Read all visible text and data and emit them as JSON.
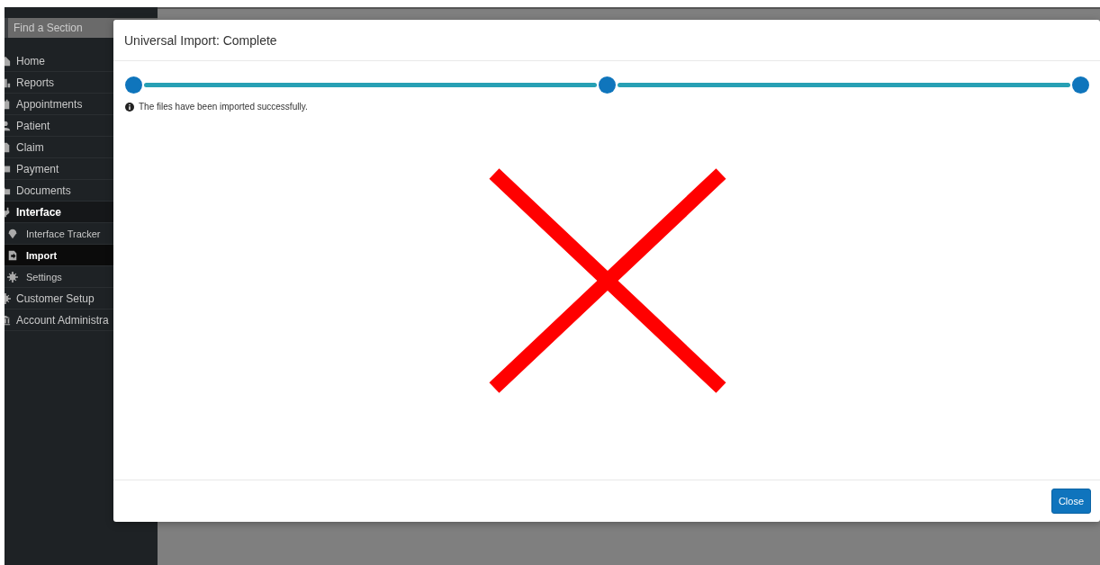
{
  "sidebar": {
    "search": {
      "placeholder": "Find a Section"
    },
    "items": [
      {
        "label": "Home",
        "selected": false
      },
      {
        "label": "Reports",
        "selected": false
      },
      {
        "label": "Appointments",
        "selected": false
      },
      {
        "label": "Patient",
        "selected": false
      },
      {
        "label": "Claim",
        "selected": false
      },
      {
        "label": "Payment",
        "selected": false
      },
      {
        "label": "Documents",
        "selected": false
      },
      {
        "label": "Interface",
        "selected": false,
        "expanded": true,
        "children": [
          {
            "label": "Interface Tracker",
            "selected": false
          },
          {
            "label": "Import",
            "selected": true
          },
          {
            "label": "Settings",
            "selected": false
          }
        ]
      },
      {
        "label": "Customer Setup",
        "selected": false
      },
      {
        "label": "Account Administra",
        "selected": false
      }
    ]
  },
  "dialog": {
    "title": "Universal Import: Complete",
    "steps": [
      {
        "done": true
      },
      {
        "done": true
      },
      {
        "done": true
      }
    ],
    "message": "The files have been imported successfully.",
    "buttons": [
      "Close"
    ]
  }
}
